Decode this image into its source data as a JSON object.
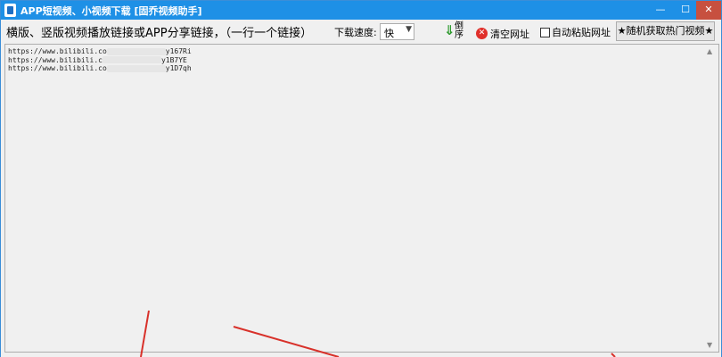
{
  "window": {
    "title": "APP短视频、小视频下载 [固乔视频助手]",
    "controls": {
      "minimize": "—",
      "maximize": "☐",
      "close": "✕"
    }
  },
  "toolbar": {
    "hint": "横版、竖版视频播放链接或APP分享链接，（一行一个链接）",
    "speed_label": "下载速度:",
    "speed_value": "快",
    "reverse_label": "倒序",
    "clear_label": "清空网址",
    "auto_paste_label": "自动粘贴网址",
    "random_label": "★随机获取热门视频★"
  },
  "links": [
    {
      "prefix": "https://www.bilibili.co",
      "suffix": "y167Ri"
    },
    {
      "prefix": "https://www.bilibili.c",
      "suffix": "y1B7YE"
    },
    {
      "prefix": "https://www.bilibili.co",
      "suffix": "y1D7qh"
    }
  ],
  "colors": {
    "titlebar": "#1e90e6",
    "close": "#c7503f",
    "arrow_red": "#d8312a",
    "reverse_arrow": "#2e9a2e",
    "clear_icon": "#e0302b"
  }
}
